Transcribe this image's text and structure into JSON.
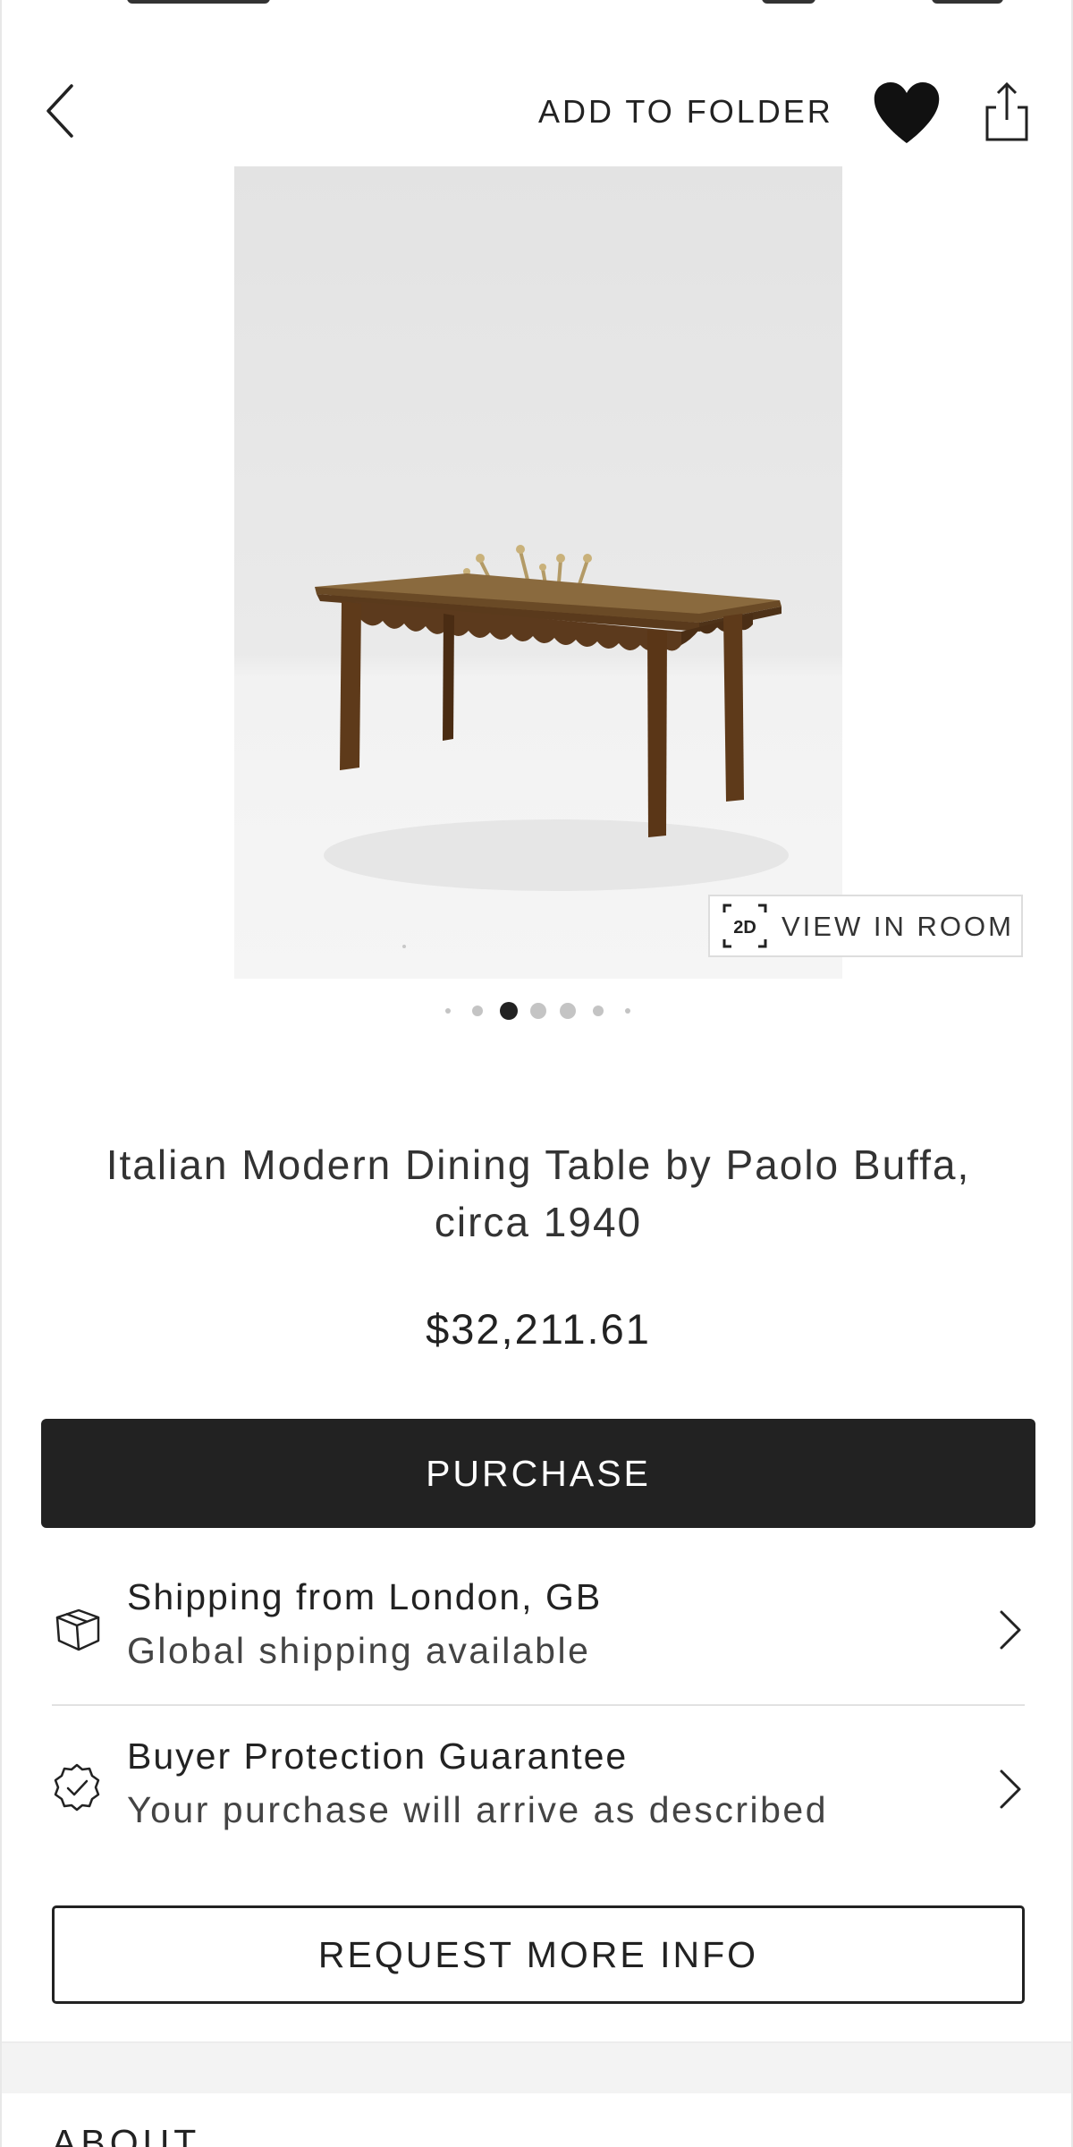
{
  "header": {
    "add_to_folder_label": "ADD TO FOLDER"
  },
  "image_overlay": {
    "view_in_room_badge": "2D",
    "view_in_room_label": "VIEW IN ROOM"
  },
  "carousel": {
    "total_dots": 7,
    "active_index": 2
  },
  "product": {
    "title": "Italian Modern Dining Table by Paolo Buffa, circa 1940",
    "price": "$32,211.61"
  },
  "actions": {
    "purchase_label": "PURCHASE",
    "request_info_label": "REQUEST MORE INFO"
  },
  "shipping": {
    "title": "Shipping from London, GB",
    "subtitle": "Global shipping available"
  },
  "protection": {
    "title": "Buyer Protection Guarantee",
    "subtitle": "Your purchase will arrive as described"
  },
  "section": {
    "about_label": "ABOUT"
  },
  "icons": {
    "back": "chevron-left-icon",
    "favorite": "heart-icon",
    "share": "share-icon",
    "shipping": "package-icon",
    "protection": "shield-check-icon",
    "row_chevron": "chevron-right-icon"
  },
  "colors": {
    "primary_button": "#222222",
    "text": "#222222",
    "divider": "#e2e2e2"
  }
}
